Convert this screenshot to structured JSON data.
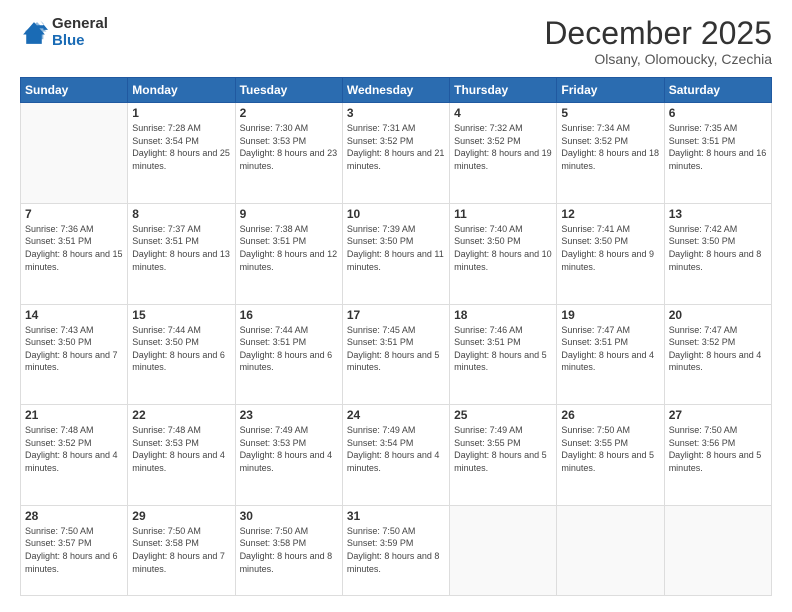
{
  "logo": {
    "general": "General",
    "blue": "Blue"
  },
  "header": {
    "month": "December 2025",
    "location": "Olsany, Olomoucky, Czechia"
  },
  "weekdays": [
    "Sunday",
    "Monday",
    "Tuesday",
    "Wednesday",
    "Thursday",
    "Friday",
    "Saturday"
  ],
  "weeks": [
    [
      {
        "day": "",
        "empty": true
      },
      {
        "day": "1",
        "sunrise": "7:28 AM",
        "sunset": "3:54 PM",
        "daylight": "8 hours and 25 minutes."
      },
      {
        "day": "2",
        "sunrise": "7:30 AM",
        "sunset": "3:53 PM",
        "daylight": "8 hours and 23 minutes."
      },
      {
        "day": "3",
        "sunrise": "7:31 AM",
        "sunset": "3:52 PM",
        "daylight": "8 hours and 21 minutes."
      },
      {
        "day": "4",
        "sunrise": "7:32 AM",
        "sunset": "3:52 PM",
        "daylight": "8 hours and 19 minutes."
      },
      {
        "day": "5",
        "sunrise": "7:34 AM",
        "sunset": "3:52 PM",
        "daylight": "8 hours and 18 minutes."
      },
      {
        "day": "6",
        "sunrise": "7:35 AM",
        "sunset": "3:51 PM",
        "daylight": "8 hours and 16 minutes."
      }
    ],
    [
      {
        "day": "7",
        "sunrise": "7:36 AM",
        "sunset": "3:51 PM",
        "daylight": "8 hours and 15 minutes."
      },
      {
        "day": "8",
        "sunrise": "7:37 AM",
        "sunset": "3:51 PM",
        "daylight": "8 hours and 13 minutes."
      },
      {
        "day": "9",
        "sunrise": "7:38 AM",
        "sunset": "3:51 PM",
        "daylight": "8 hours and 12 minutes."
      },
      {
        "day": "10",
        "sunrise": "7:39 AM",
        "sunset": "3:50 PM",
        "daylight": "8 hours and 11 minutes."
      },
      {
        "day": "11",
        "sunrise": "7:40 AM",
        "sunset": "3:50 PM",
        "daylight": "8 hours and 10 minutes."
      },
      {
        "day": "12",
        "sunrise": "7:41 AM",
        "sunset": "3:50 PM",
        "daylight": "8 hours and 9 minutes."
      },
      {
        "day": "13",
        "sunrise": "7:42 AM",
        "sunset": "3:50 PM",
        "daylight": "8 hours and 8 minutes."
      }
    ],
    [
      {
        "day": "14",
        "sunrise": "7:43 AM",
        "sunset": "3:50 PM",
        "daylight": "8 hours and 7 minutes."
      },
      {
        "day": "15",
        "sunrise": "7:44 AM",
        "sunset": "3:50 PM",
        "daylight": "8 hours and 6 minutes."
      },
      {
        "day": "16",
        "sunrise": "7:44 AM",
        "sunset": "3:51 PM",
        "daylight": "8 hours and 6 minutes."
      },
      {
        "day": "17",
        "sunrise": "7:45 AM",
        "sunset": "3:51 PM",
        "daylight": "8 hours and 5 minutes."
      },
      {
        "day": "18",
        "sunrise": "7:46 AM",
        "sunset": "3:51 PM",
        "daylight": "8 hours and 5 minutes."
      },
      {
        "day": "19",
        "sunrise": "7:47 AM",
        "sunset": "3:51 PM",
        "daylight": "8 hours and 4 minutes."
      },
      {
        "day": "20",
        "sunrise": "7:47 AM",
        "sunset": "3:52 PM",
        "daylight": "8 hours and 4 minutes."
      }
    ],
    [
      {
        "day": "21",
        "sunrise": "7:48 AM",
        "sunset": "3:52 PM",
        "daylight": "8 hours and 4 minutes."
      },
      {
        "day": "22",
        "sunrise": "7:48 AM",
        "sunset": "3:53 PM",
        "daylight": "8 hours and 4 minutes."
      },
      {
        "day": "23",
        "sunrise": "7:49 AM",
        "sunset": "3:53 PM",
        "daylight": "8 hours and 4 minutes."
      },
      {
        "day": "24",
        "sunrise": "7:49 AM",
        "sunset": "3:54 PM",
        "daylight": "8 hours and 4 minutes."
      },
      {
        "day": "25",
        "sunrise": "7:49 AM",
        "sunset": "3:55 PM",
        "daylight": "8 hours and 5 minutes."
      },
      {
        "day": "26",
        "sunrise": "7:50 AM",
        "sunset": "3:55 PM",
        "daylight": "8 hours and 5 minutes."
      },
      {
        "day": "27",
        "sunrise": "7:50 AM",
        "sunset": "3:56 PM",
        "daylight": "8 hours and 5 minutes."
      }
    ],
    [
      {
        "day": "28",
        "sunrise": "7:50 AM",
        "sunset": "3:57 PM",
        "daylight": "8 hours and 6 minutes."
      },
      {
        "day": "29",
        "sunrise": "7:50 AM",
        "sunset": "3:58 PM",
        "daylight": "8 hours and 7 minutes."
      },
      {
        "day": "30",
        "sunrise": "7:50 AM",
        "sunset": "3:58 PM",
        "daylight": "8 hours and 8 minutes."
      },
      {
        "day": "31",
        "sunrise": "7:50 AM",
        "sunset": "3:59 PM",
        "daylight": "8 hours and 8 minutes."
      },
      {
        "day": "",
        "empty": true
      },
      {
        "day": "",
        "empty": true
      },
      {
        "day": "",
        "empty": true
      }
    ]
  ],
  "labels": {
    "sunrise": "Sunrise:",
    "sunset": "Sunset:",
    "daylight": "Daylight:"
  }
}
